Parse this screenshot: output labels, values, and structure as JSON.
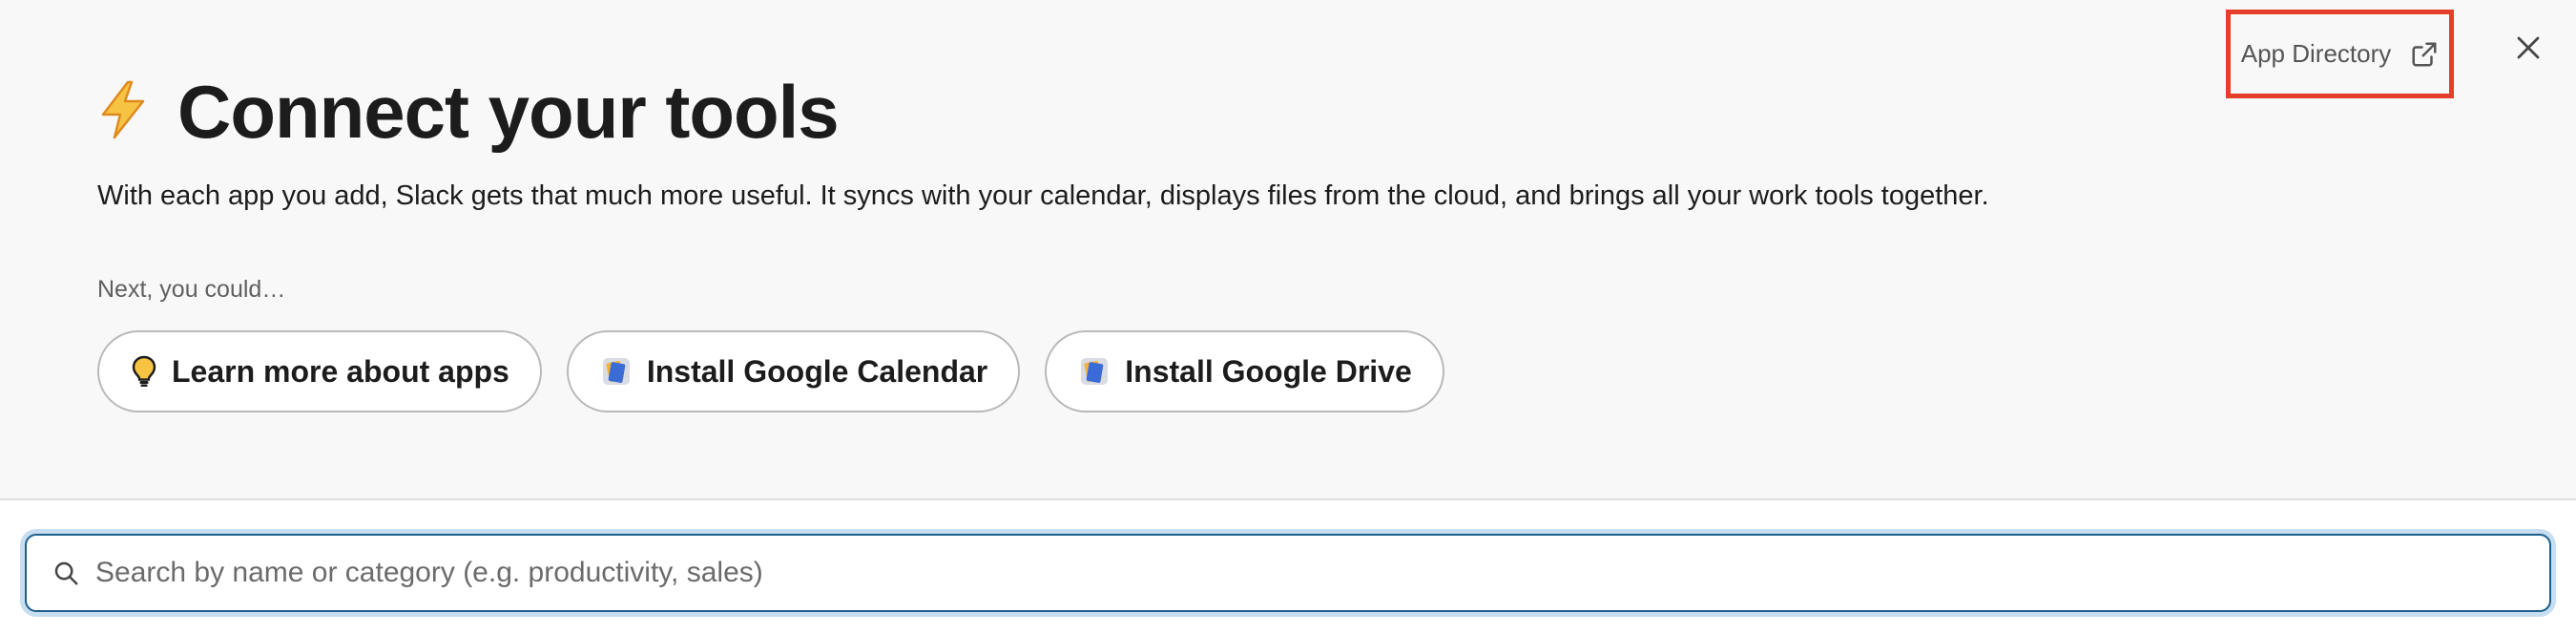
{
  "header": {
    "app_directory_label": "App Directory",
    "app_directory_icon": "external-link-icon",
    "close_icon": "close-icon"
  },
  "hero": {
    "icon": "lightning-bolt-icon",
    "title": "Connect your tools",
    "description": "With each app you add, Slack gets that much more useful. It syncs with your calendar, displays files from the cloud, and brings all your work tools together.",
    "next_label": "Next, you could…",
    "suggestions": [
      {
        "label": "Learn more about apps",
        "icon": "lightbulb-icon"
      },
      {
        "label": "Install Google Calendar",
        "icon": "app-icon"
      },
      {
        "label": "Install Google Drive",
        "icon": "app-icon"
      }
    ]
  },
  "search": {
    "placeholder": "Search by name or category (e.g. productivity, sales)",
    "value": ""
  },
  "colors": {
    "highlight_border": "#e53e2b",
    "search_border": "#1d5e8c",
    "bolt": "#f2b320"
  }
}
